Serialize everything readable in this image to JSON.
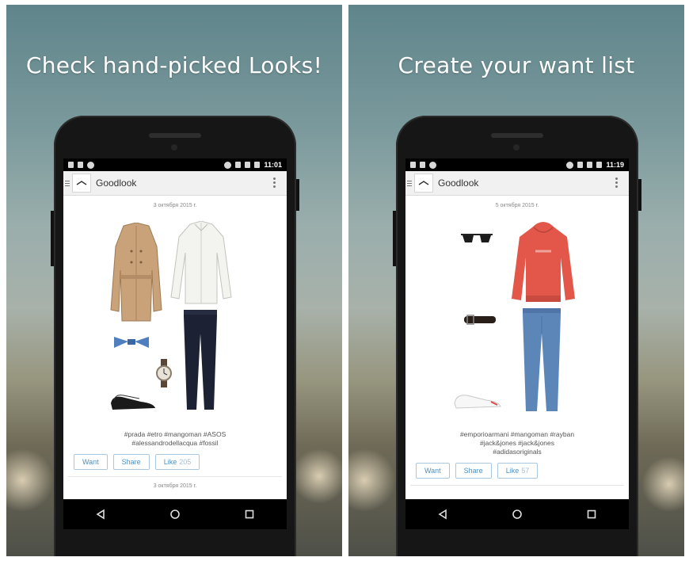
{
  "panels": [
    {
      "headline": "Check hand-picked Looks!",
      "status_time": "11:01",
      "app_title": "Goodlook",
      "date": "3 октября 2015 г.",
      "tags_line1": "#prada #etro #mangoman #ASOS",
      "tags_line2": "#alessandrodellacqua #fossil",
      "tags_line3": "",
      "want_label": "Want",
      "share_label": "Share",
      "like_label": "Like",
      "like_count": "205",
      "next_date": "3 октября 2015 г."
    },
    {
      "headline": "Create your want list",
      "status_time": "11:19",
      "app_title": "Goodlook",
      "date": "5 октября 2015 г.",
      "tags_line1": "#emporioarmani #mangoman #rayban",
      "tags_line2": "#jack&jones #jack&jones",
      "tags_line3": "#adidasoriginals",
      "want_label": "Want",
      "share_label": "Share",
      "like_label": "Like",
      "like_count": "57",
      "next_date": ""
    }
  ],
  "colors": {
    "accent": "#4a90c4",
    "sky_top": "#5f858b",
    "status_bar": "#000000"
  },
  "icons": {
    "nav_back": "triangle-back-icon",
    "nav_home": "circle-home-icon",
    "nav_recents": "square-recents-icon"
  }
}
